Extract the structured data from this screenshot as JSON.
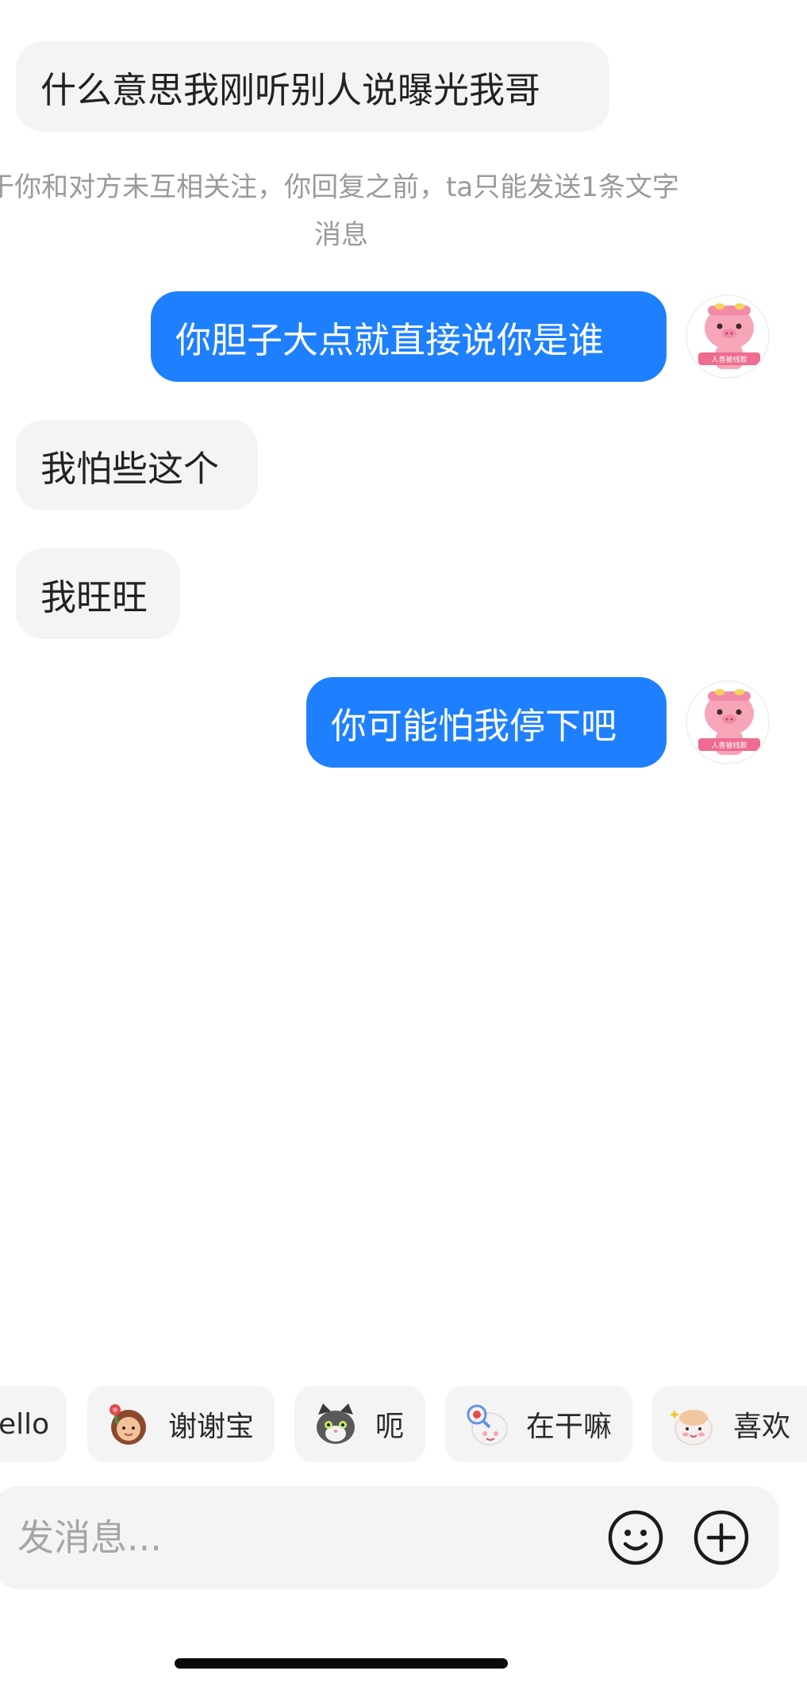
{
  "messages": [
    {
      "side": "incoming",
      "text": "什么意思我刚听别人说曝光我哥"
    },
    {
      "side": "outgoing",
      "text": "你胆子大点就直接说你是谁"
    },
    {
      "side": "incoming",
      "text": "我怕些这个"
    },
    {
      "side": "incoming",
      "text": "我旺旺"
    },
    {
      "side": "outgoing",
      "text": "你可能怕我停下吧"
    }
  ],
  "notice": {
    "line1": "于你和对方未互相关注，你回复之前，ta只能发送1条文字",
    "line2": "消息"
  },
  "avatar": {
    "icon": "pink-pig-avatar-icon",
    "tag_text": "人善被线欺"
  },
  "quick_replies": [
    {
      "label": "ello",
      "icon": ""
    },
    {
      "label": "谢谢宝",
      "icon": "girl-with-flower-sticker-icon"
    },
    {
      "label": "呃",
      "icon": "gray-cat-sticker-icon"
    },
    {
      "label": "在干嘛",
      "icon": "magnifier-bear-sticker-icon"
    },
    {
      "label": "喜欢",
      "icon": "sparkle-bear-sticker-icon"
    }
  ],
  "input": {
    "placeholder": "发消息..."
  },
  "colors": {
    "outgoing_bubble": "#1e80ff",
    "incoming_bubble": "#f4f4f4",
    "notice_text": "#9a9a9a"
  }
}
